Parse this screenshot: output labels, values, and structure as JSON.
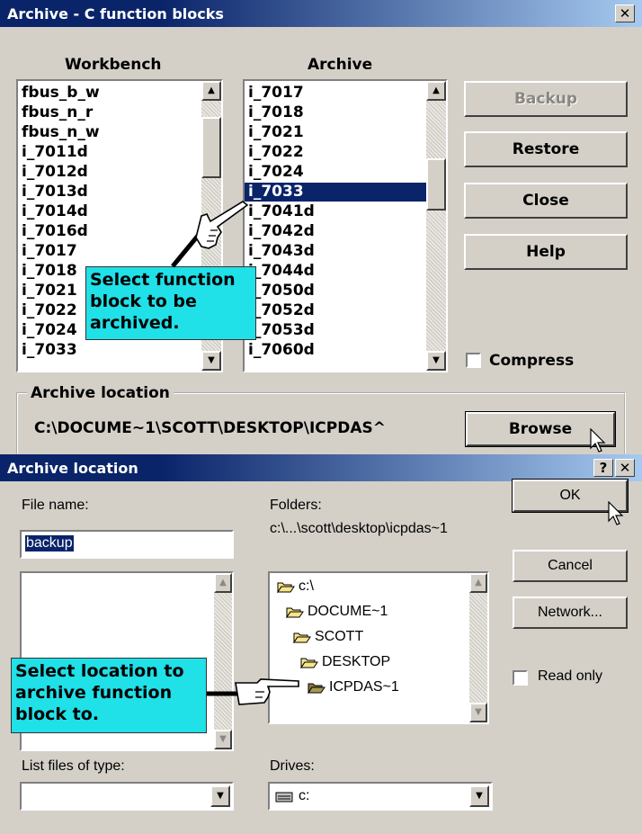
{
  "archive_dialog": {
    "title": "Archive - C function blocks",
    "close_glyph": "✕",
    "workbench_label": "Workbench",
    "archive_label": "Archive",
    "workbench_items": [
      "fbus_b_w",
      "fbus_n_r",
      "fbus_n_w",
      "i_7011d",
      "i_7012d",
      "i_7013d",
      "i_7014d",
      "i_7016d",
      "i_7017",
      "i_7018",
      "i_7021",
      "i_7022",
      "i_7024",
      "i_7033"
    ],
    "archive_items": [
      "i_7017",
      "i_7018",
      "i_7021",
      "i_7022",
      "i_7024",
      "i_7033",
      "i_7041d",
      "i_7042d",
      "i_7043d",
      "i_7044d",
      "i_7050d",
      "i_7052d",
      "i_7053d",
      "i_7060d"
    ],
    "selected_archive_item": "i_7033",
    "buttons": {
      "backup": "Backup",
      "restore": "Restore",
      "close": "Close",
      "help": "Help",
      "browse": "Browse"
    },
    "compress_label": "Compress",
    "compress_checked": false,
    "location_group_label": "Archive location",
    "location_path": "C:\\DOCUME~1\\SCOTT\\DESKTOP\\ICPDAS^",
    "callout_text": [
      "Select function",
      "block to be",
      "archived."
    ]
  },
  "location_dialog": {
    "title": "Archive location",
    "help_glyph": "?",
    "close_glyph": "✕",
    "file_name_label": "File name:",
    "file_name_value": "backup",
    "folders_label": "Folders:",
    "folders_path": "c:\\...\\scott\\desktop\\icpdas~1",
    "folder_tree": [
      "c:\\",
      "DOCUME~1",
      "SCOTT",
      "DESKTOP",
      "ICPDAS~1"
    ],
    "selected_folder": "ICPDAS~1",
    "buttons": {
      "ok": "OK",
      "cancel": "Cancel",
      "network": "Network..."
    },
    "read_only_label": "Read only",
    "read_only_checked": false,
    "list_files_label": "List files of type:",
    "list_files_value": "",
    "drives_label": "Drives:",
    "drives_value": "c:",
    "callout_text": [
      "Select location to",
      "archive function",
      "block to."
    ]
  },
  "colors": {
    "title_active": "#0a246a",
    "dialog_face": "#d4d0c8",
    "selection": "#0a246a",
    "callout": "#20e0e8"
  }
}
